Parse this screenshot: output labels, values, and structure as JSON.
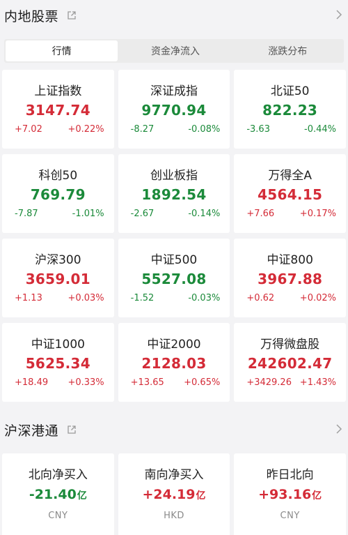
{
  "colors": {
    "up": "#d42b37",
    "down": "#1b8a3a",
    "background": "#f3f3f5"
  },
  "mainland": {
    "title": "内地股票",
    "tabs": [
      {
        "label": "行情",
        "active": true
      },
      {
        "label": "资金净流入",
        "active": false
      },
      {
        "label": "涨跌分布",
        "active": false
      }
    ],
    "indices": [
      {
        "name": "上证指数",
        "price": "3147.74",
        "change": "+7.02",
        "pct": "+0.22%",
        "dir": "up"
      },
      {
        "name": "深证成指",
        "price": "9770.94",
        "change": "-8.27",
        "pct": "-0.08%",
        "dir": "down"
      },
      {
        "name": "北证50",
        "price": "822.23",
        "change": "-3.63",
        "pct": "-0.44%",
        "dir": "down"
      },
      {
        "name": "科创50",
        "price": "769.79",
        "change": "-7.87",
        "pct": "-1.01%",
        "dir": "down"
      },
      {
        "name": "创业板指",
        "price": "1892.54",
        "change": "-2.67",
        "pct": "-0.14%",
        "dir": "down"
      },
      {
        "name": "万得全A",
        "price": "4564.15",
        "change": "+7.66",
        "pct": "+0.17%",
        "dir": "up"
      },
      {
        "name": "沪深300",
        "price": "3659.01",
        "change": "+1.13",
        "pct": "+0.03%",
        "dir": "up"
      },
      {
        "name": "中证500",
        "price": "5527.08",
        "change": "-1.52",
        "pct": "-0.03%",
        "dir": "down"
      },
      {
        "name": "中证800",
        "price": "3967.88",
        "change": "+0.62",
        "pct": "+0.02%",
        "dir": "up"
      },
      {
        "name": "中证1000",
        "price": "5625.34",
        "change": "+18.49",
        "pct": "+0.33%",
        "dir": "up"
      },
      {
        "name": "中证2000",
        "price": "2128.03",
        "change": "+13.65",
        "pct": "+0.65%",
        "dir": "up"
      },
      {
        "name": "万得微盘股",
        "price": "242602.47",
        "change": "+3429.26",
        "pct": "+1.43%",
        "dir": "up"
      }
    ]
  },
  "hk_connect": {
    "title": "沪深港通",
    "items": [
      {
        "name": "北向净买入",
        "value": "-21.40",
        "unit": "亿",
        "currency": "CNY",
        "dir": "down"
      },
      {
        "name": "南向净买入",
        "value": "+24.19",
        "unit": "亿",
        "currency": "HKD",
        "dir": "up"
      },
      {
        "name": "昨日北向",
        "value": "+93.16",
        "unit": "亿",
        "currency": "CNY",
        "dir": "up"
      }
    ]
  },
  "icons": {
    "external": "external-link-icon",
    "chevron": "chevron-right-icon"
  }
}
